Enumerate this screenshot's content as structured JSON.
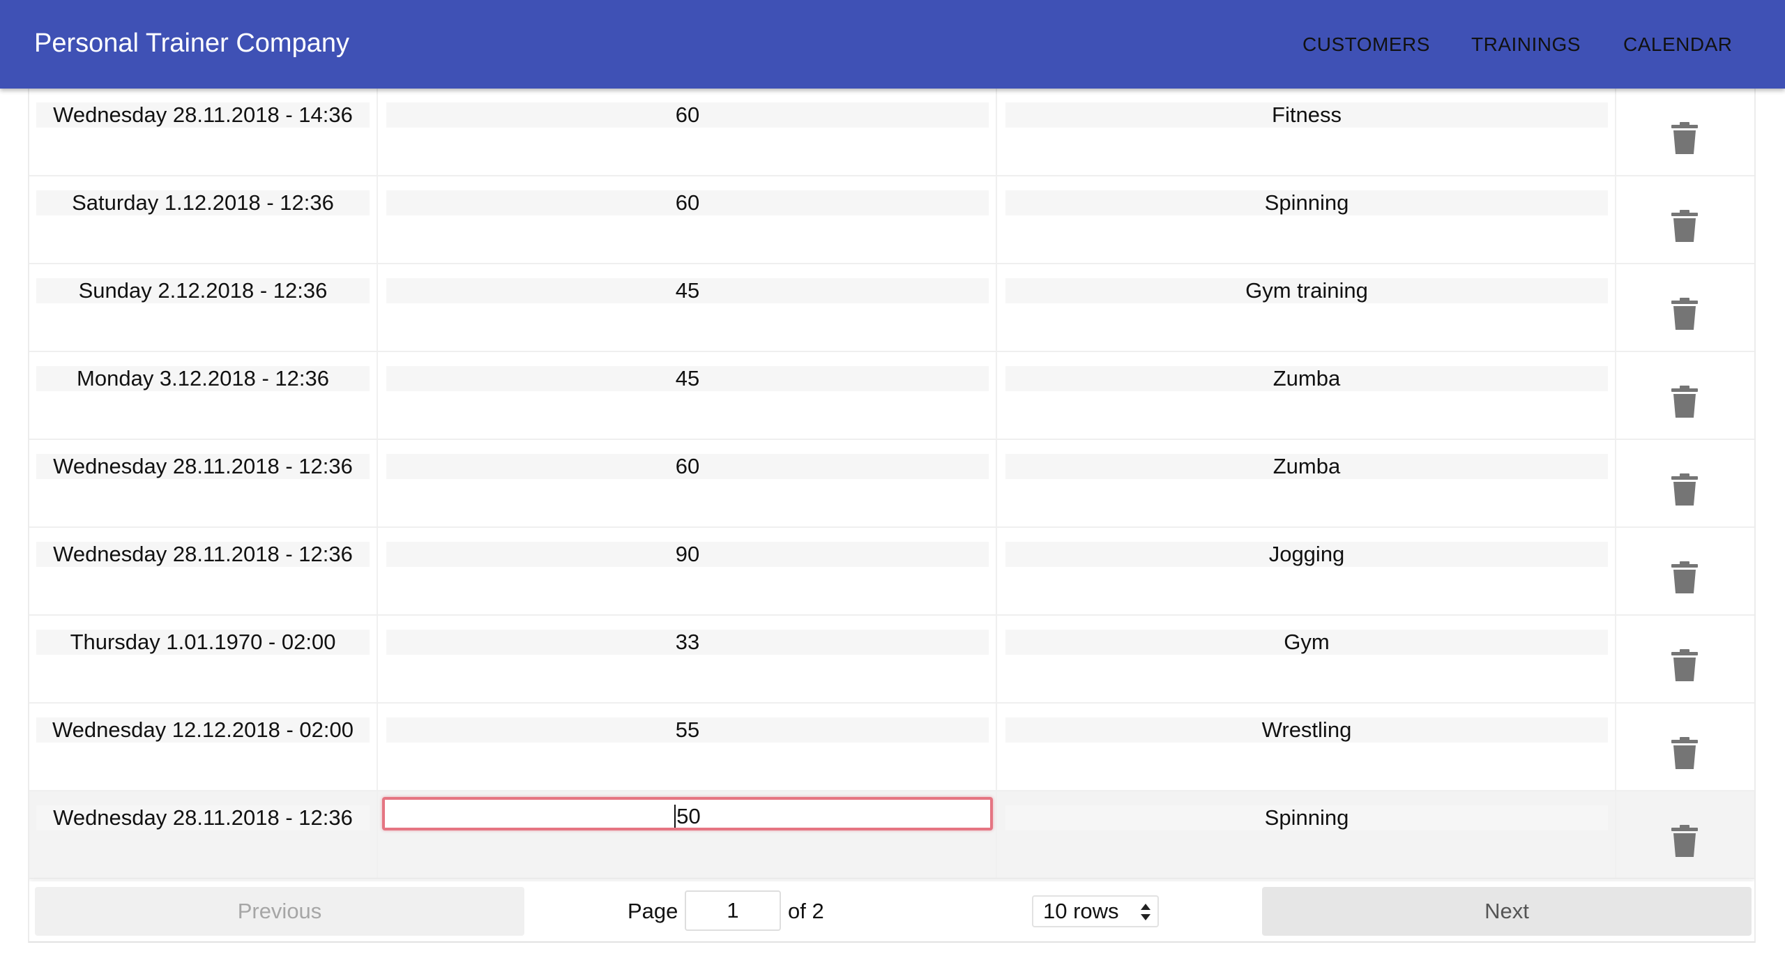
{
  "appbar": {
    "title": "Personal Trainer Company",
    "nav": [
      "CUSTOMERS",
      "TRAININGS",
      "CALENDAR"
    ]
  },
  "table": {
    "rows": [
      {
        "date": "Wednesday 28.11.2018 - 14:36",
        "duration": "60",
        "activity": "Fitness"
      },
      {
        "date": "Saturday 1.12.2018 - 12:36",
        "duration": "60",
        "activity": "Spinning"
      },
      {
        "date": "Sunday 2.12.2018 - 12:36",
        "duration": "45",
        "activity": "Gym training"
      },
      {
        "date": "Monday 3.12.2018 - 12:36",
        "duration": "45",
        "activity": "Zumba"
      },
      {
        "date": "Wednesday 28.11.2018 - 12:36",
        "duration": "60",
        "activity": "Zumba"
      },
      {
        "date": "Wednesday 28.11.2018 - 12:36",
        "duration": "90",
        "activity": "Jogging"
      },
      {
        "date": "Thursday 1.01.1970 - 02:00",
        "duration": "33",
        "activity": "Gym"
      },
      {
        "date": "Wednesday 12.12.2018 - 02:00",
        "duration": "55",
        "activity": "Wrestling"
      },
      {
        "date": "Wednesday 28.11.2018 - 12:36",
        "duration": "50",
        "activity": "Spinning"
      }
    ],
    "delete_icon": "trash-icon"
  },
  "pagination": {
    "previous_label": "Previous",
    "page_label": "Page",
    "page_value": "1",
    "of_label": "of 2",
    "rows_selected": "10 rows",
    "next_label": "Next"
  },
  "colors": {
    "appbar": "#3f51b5",
    "edit_border": "#e57582",
    "trash": "#757575"
  }
}
